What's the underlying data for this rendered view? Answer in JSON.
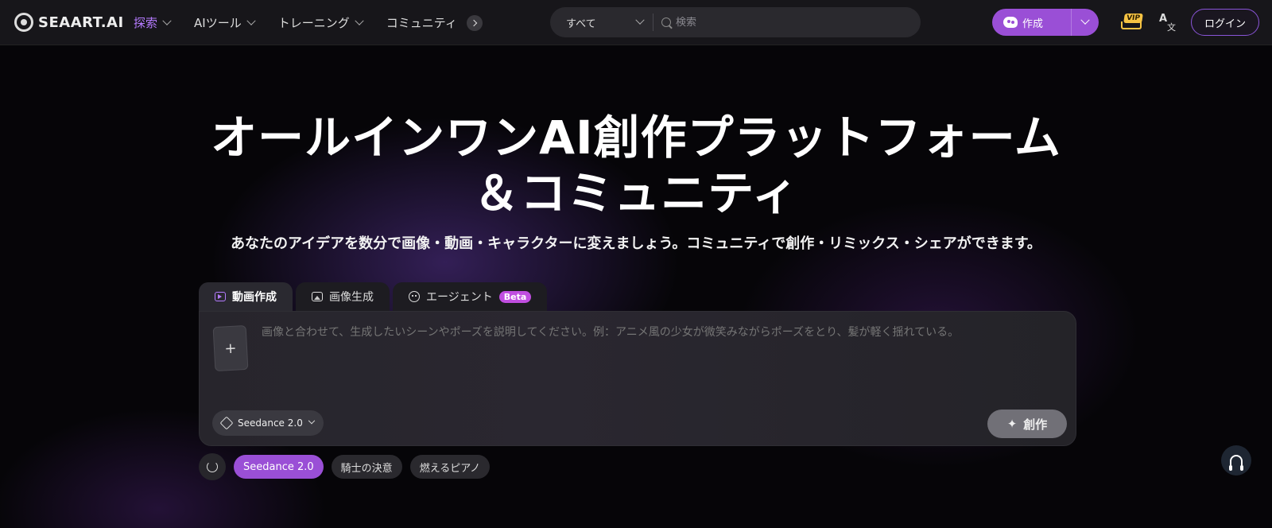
{
  "header": {
    "logo_text": "SEAART.AI",
    "nav": [
      {
        "label": "探索"
      },
      {
        "label": "AIツール"
      },
      {
        "label": "トレーニング"
      },
      {
        "label": "コミュニティ"
      }
    ],
    "search": {
      "scope": "すべて",
      "placeholder": "検索"
    },
    "create_label": "作成",
    "vip_label": "VIP",
    "lang_a": "A",
    "lang_b": "文",
    "login_label": "ログイン"
  },
  "hero": {
    "title_line1": "オールインワンAI創作プラットフォーム",
    "title_line2": "＆コミュニティ",
    "subtitle": "あなたのアイデアを数分で画像・動画・キャラクターに変えましょう。コミュニティで創作・リミックス・シェアができます。"
  },
  "tabs": [
    {
      "label": "動画作成",
      "icon": "video-icon"
    },
    {
      "label": "画像生成",
      "icon": "image-icon"
    },
    {
      "label": "エージェント",
      "icon": "agent-icon",
      "badge": "Beta"
    }
  ],
  "prompt": {
    "upload_glyph": "+",
    "placeholder": "画像と合わせて、生成したいシーンやポーズを説明してください。例：アニメ風の少女が微笑みながらポーズをとり、髪が軽く揺れている。",
    "model": "Seedance 2.0",
    "generate_label": "創作",
    "sparkle": "✦"
  },
  "chips": [
    {
      "label": "Seedance 2.0",
      "active": true
    },
    {
      "label": "騎士の決意",
      "active": false
    },
    {
      "label": "燃えるピアノ",
      "active": false
    }
  ],
  "colors": {
    "accent": "#9a4fd6",
    "nav_active": "#b57bff",
    "beta": "#c04ee0"
  }
}
